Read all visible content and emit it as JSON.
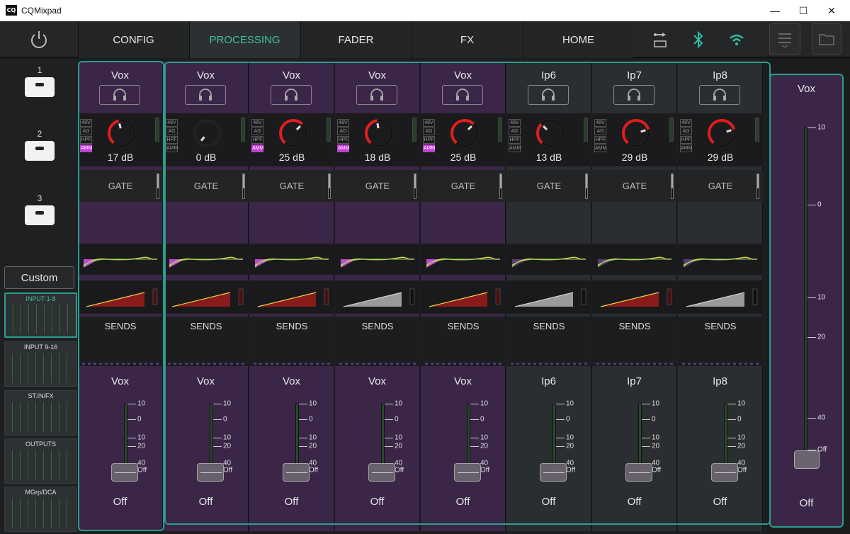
{
  "window": {
    "title": "CQMixpad",
    "logo": "CQ",
    "minimize": "—",
    "maximize": "☐",
    "close": "✕"
  },
  "tabs": [
    {
      "label": "CONFIG",
      "active": false
    },
    {
      "label": "PROCESSING",
      "active": true
    },
    {
      "label": "FADER",
      "active": false
    },
    {
      "label": "FX",
      "active": false
    },
    {
      "label": "HOME",
      "active": false
    }
  ],
  "top_icons": [
    "usb-icon",
    "bluetooth-icon",
    "wifi-icon",
    "menu-icon",
    "folder-icon"
  ],
  "accent": "#2a9d8c",
  "scenes": [
    {
      "label": "1"
    },
    {
      "label": "2"
    },
    {
      "label": "3"
    }
  ],
  "custom_label": "Custom",
  "banks": [
    {
      "label": "INPUT 1-8",
      "active": true
    },
    {
      "label": "INPUT 9-16",
      "active": false
    },
    {
      "label": "ST.IN/FX",
      "active": false
    },
    {
      "label": "OUTPUTS",
      "active": false
    },
    {
      "label": "MGrp/DCA",
      "active": false
    }
  ],
  "channels": [
    {
      "name": "Vox",
      "gain": "17 dB",
      "gain_level": 0.45,
      "amm": true,
      "style": "vox",
      "fader_name": "Vox",
      "fader_value": "Off",
      "comp": "red"
    },
    {
      "name": "Vox",
      "gain": "0 dB",
      "gain_level": 0.0,
      "amm": false,
      "style": "vox",
      "fader_name": "Vox",
      "fader_value": "Off",
      "comp": "red"
    },
    {
      "name": "Vox",
      "gain": "25 dB",
      "gain_level": 0.66,
      "amm": true,
      "style": "vox",
      "fader_name": "Vox",
      "fader_value": "Off",
      "comp": "red"
    },
    {
      "name": "Vox",
      "gain": "18 dB",
      "gain_level": 0.47,
      "amm": true,
      "style": "vox",
      "fader_name": "Vox",
      "fader_value": "Off",
      "comp": "grey"
    },
    {
      "name": "Vox",
      "gain": "25 dB",
      "gain_level": 0.66,
      "amm": true,
      "style": "vox",
      "fader_name": "Vox",
      "fader_value": "Off",
      "comp": "red"
    },
    {
      "name": "Ip6",
      "gain": "13 dB",
      "gain_level": 0.34,
      "amm": false,
      "style": "ip",
      "fader_name": "Ip6",
      "fader_value": "Off",
      "comp": "grey"
    },
    {
      "name": "Ip7",
      "gain": "29 dB",
      "gain_level": 0.76,
      "amm": false,
      "style": "ip",
      "fader_name": "Ip7",
      "fader_value": "Off",
      "comp": "red"
    },
    {
      "name": "Ip8",
      "gain": "29 dB",
      "gain_level": 0.76,
      "amm": false,
      "style": "ip",
      "fader_name": "Ip8",
      "fader_value": "Off",
      "comp": "grey"
    }
  ],
  "preamp_tags": [
    "48V",
    "AG",
    "HPF",
    "AMM"
  ],
  "gate_label": "GATE",
  "sends_label": "SENDS",
  "fader_scale": [
    "10",
    "0",
    "10",
    "20",
    "40",
    "Off"
  ],
  "master": {
    "name": "Vox",
    "value": "Off",
    "scale": [
      "10",
      "0",
      "10",
      "20",
      "40",
      "Off"
    ]
  }
}
